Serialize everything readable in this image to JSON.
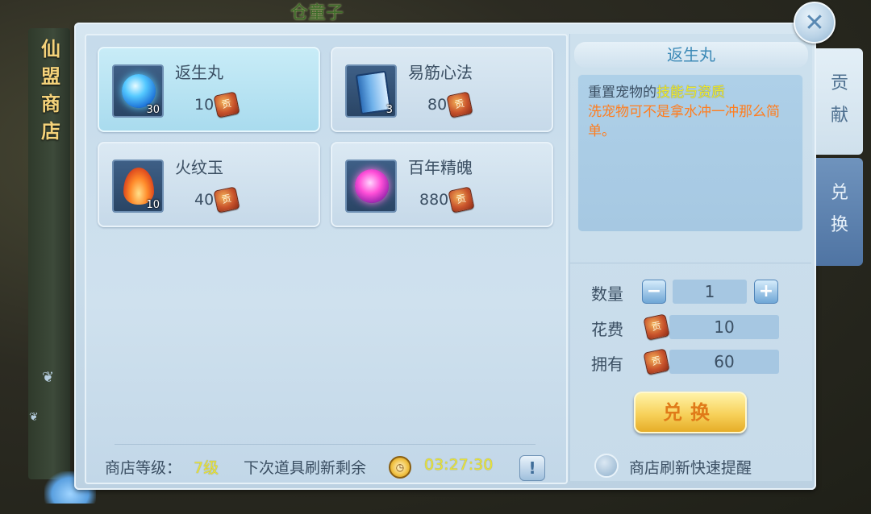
{
  "background": {
    "top_text": "仓童子"
  },
  "shop": {
    "title_chars": [
      "仙",
      "盟",
      "商",
      "店"
    ]
  },
  "tabs": [
    {
      "label_chars": [
        "贡",
        "献"
      ],
      "active": true
    },
    {
      "label_chars": [
        "兑",
        "换"
      ],
      "active": false
    }
  ],
  "items": [
    {
      "name": "返生丸",
      "price": "10",
      "qty": "30",
      "icon": "blue-orb-icon",
      "selected": true
    },
    {
      "name": "易筋心法",
      "price": "80",
      "qty": "3",
      "icon": "book-icon",
      "selected": false
    },
    {
      "name": "火纹玉",
      "price": "40",
      "qty": "10",
      "icon": "flame-jade-icon",
      "selected": false
    },
    {
      "name": "百年精魄",
      "price": "880",
      "qty": "",
      "icon": "purple-soul-icon",
      "selected": false
    }
  ],
  "currency_icon": "contribution-token-icon",
  "status_bar": {
    "level_label": "商店等级：",
    "level_value": "7级",
    "refresh_label": "下次道具刷新剩余",
    "refresh_time": "03:27:30"
  },
  "detail": {
    "title": "返生丸",
    "desc_prefix": "重置宠物的",
    "desc_highlight": "技能与资质",
    "desc_flavor": "洗宠物可不是拿水冲一冲那么简单。"
  },
  "purchase": {
    "qty_label": "数量",
    "qty_value": "1",
    "cost_label": "花费",
    "cost_value": "10",
    "owned_label": "拥有",
    "owned_value": "60",
    "minus": "−",
    "plus": "+",
    "exchange_button": "兑换",
    "reminder_label": "商店刷新快速提醒"
  },
  "colors": {
    "highlight_yellow": "#f1ec2e",
    "flavor_orange": "#ff7d1e",
    "button_gold": "#f7d15a"
  }
}
